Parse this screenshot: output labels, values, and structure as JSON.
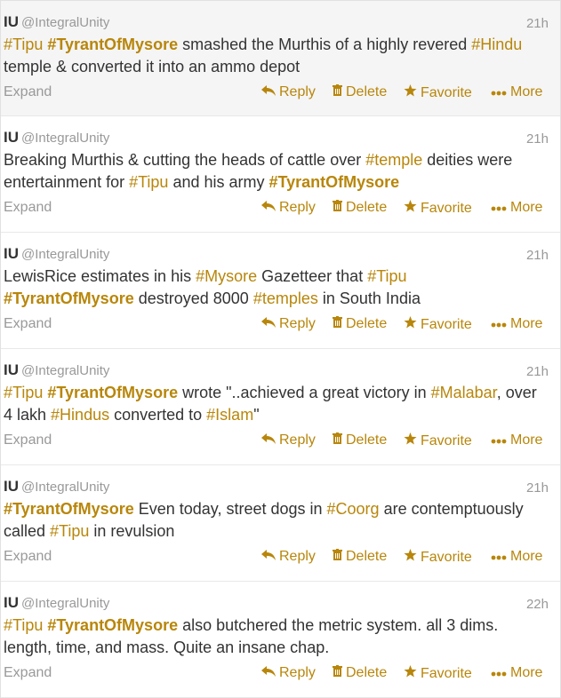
{
  "actions": {
    "expand": "Expand",
    "reply": "Reply",
    "delete": "Delete",
    "favorite": "Favorite",
    "more": "More",
    "icons": {
      "reply": "reply-arrow-icon",
      "delete": "trash-icon",
      "favorite": "star-icon",
      "more": "dots-icon"
    }
  },
  "colors": {
    "hashtag": "#b8860b",
    "muted": "#999999",
    "text": "#333333"
  },
  "tweets": [
    {
      "name": "IU",
      "handle": "@IntegralUnity",
      "time": "21h",
      "parts": [
        {
          "t": "#Tipu",
          "tag": true,
          "bold": false
        },
        {
          "t": " "
        },
        {
          "t": "#TyrantOfMysore",
          "tag": true,
          "bold": true
        },
        {
          "t": " smashed the Murthis of a highly revered "
        },
        {
          "t": "#Hindu",
          "tag": true,
          "bold": false
        },
        {
          "t": " temple & converted it into an ammo depot"
        }
      ]
    },
    {
      "name": "IU",
      "handle": "@IntegralUnity",
      "time": "21h",
      "parts": [
        {
          "t": "Breaking Murthis & cutting the heads of cattle over "
        },
        {
          "t": "#temple",
          "tag": true,
          "bold": false
        },
        {
          "t": " deities were entertainment for "
        },
        {
          "t": "#Tipu",
          "tag": true,
          "bold": false
        },
        {
          "t": " and his army "
        },
        {
          "t": "#TyrantOfMysore",
          "tag": true,
          "bold": true
        }
      ]
    },
    {
      "name": "IU",
      "handle": "@IntegralUnity",
      "time": "21h",
      "parts": [
        {
          "t": "LewisRice estimates in his "
        },
        {
          "t": "#Mysore",
          "tag": true,
          "bold": false
        },
        {
          "t": " Gazetteer that "
        },
        {
          "t": "#Tipu",
          "tag": true,
          "bold": false
        },
        {
          "t": " "
        },
        {
          "t": "#TyrantOfMysore",
          "tag": true,
          "bold": true
        },
        {
          "t": " destroyed 8000 "
        },
        {
          "t": "#temples",
          "tag": true,
          "bold": false
        },
        {
          "t": " in South India"
        }
      ]
    },
    {
      "name": "IU",
      "handle": "@IntegralUnity",
      "time": "21h",
      "parts": [
        {
          "t": "#Tipu",
          "tag": true,
          "bold": false
        },
        {
          "t": " "
        },
        {
          "t": "#TyrantOfMysore",
          "tag": true,
          "bold": true
        },
        {
          "t": " wrote \"..achieved a great victory in "
        },
        {
          "t": "#Malabar",
          "tag": true,
          "bold": false
        },
        {
          "t": ", over 4 lakh "
        },
        {
          "t": "#Hindus",
          "tag": true,
          "bold": false
        },
        {
          "t": " converted to "
        },
        {
          "t": "#Islam",
          "tag": true,
          "bold": false
        },
        {
          "t": "\""
        }
      ]
    },
    {
      "name": "IU",
      "handle": "@IntegralUnity",
      "time": "21h",
      "parts": [
        {
          "t": "#TyrantOfMysore",
          "tag": true,
          "bold": true
        },
        {
          "t": " Even today, street dogs in "
        },
        {
          "t": "#Coorg",
          "tag": true,
          "bold": false
        },
        {
          "t": " are contemptuously called "
        },
        {
          "t": "#Tipu",
          "tag": true,
          "bold": false
        },
        {
          "t": " in revulsion"
        }
      ]
    },
    {
      "name": "IU",
      "handle": "@IntegralUnity",
      "time": "22h",
      "parts": [
        {
          "t": "#Tipu",
          "tag": true,
          "bold": false
        },
        {
          "t": " "
        },
        {
          "t": "#TyrantOfMysore",
          "tag": true,
          "bold": true
        },
        {
          "t": " also butchered the metric system. all 3 dims. length, time, and mass. Quite an insane chap."
        }
      ]
    }
  ]
}
